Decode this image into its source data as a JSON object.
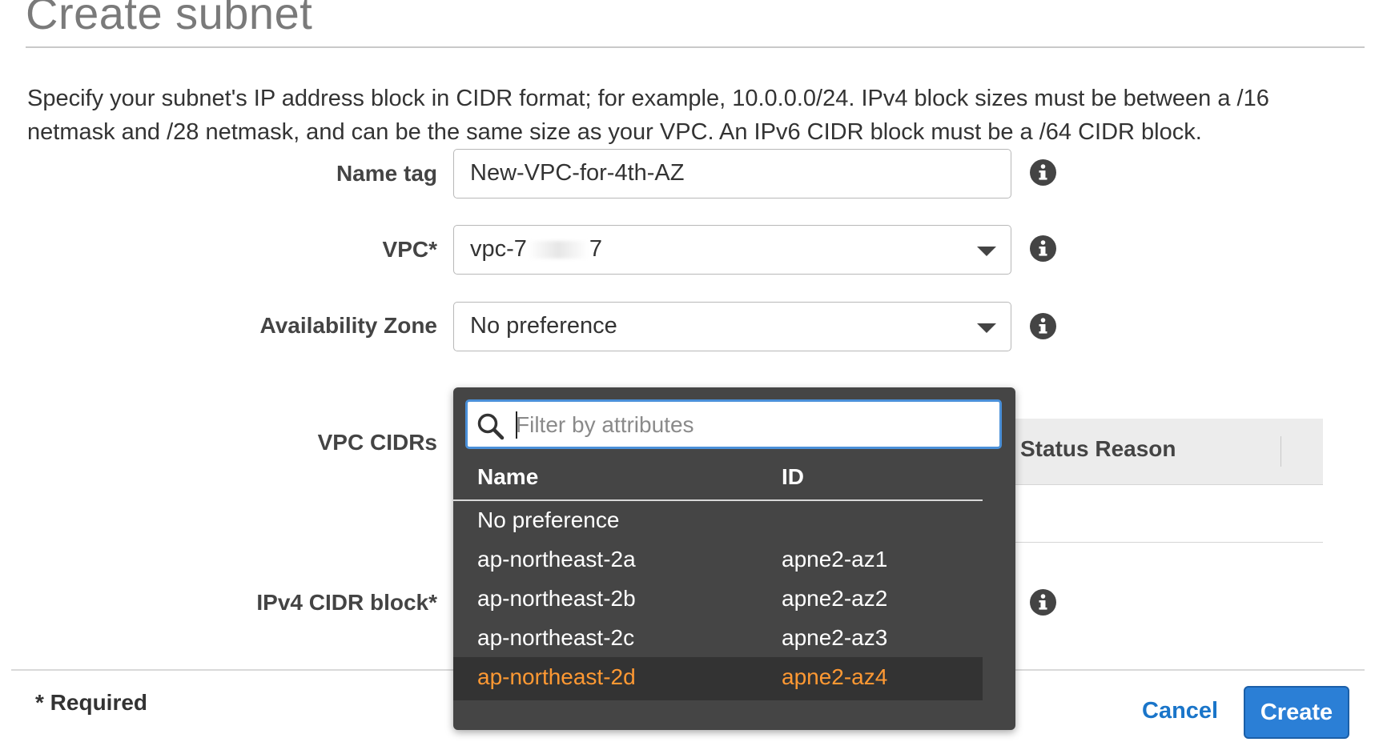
{
  "page": {
    "title": "Create subnet",
    "description": "Specify your subnet's IP address block in CIDR format; for example, 10.0.0.0/24. IPv4 block sizes must be between a /16 netmask and /28 netmask, and can be the same size as your VPC. An IPv6 CIDR block must be a /64 CIDR block."
  },
  "form": {
    "name_tag": {
      "label": "Name tag",
      "value": "New-VPC-for-4th-AZ"
    },
    "vpc": {
      "label": "VPC*",
      "value_prefix": "vpc-7",
      "value_suffix": "7"
    },
    "availability_zone": {
      "label": "Availability Zone",
      "value": "No preference"
    },
    "vpc_cidrs": {
      "label": "VPC CIDRs",
      "table_header": "Status Reason"
    },
    "ipv4_cidr": {
      "label": "IPv4 CIDR block*"
    }
  },
  "dropdown": {
    "filter_placeholder": "Filter by attributes",
    "columns": {
      "name": "Name",
      "id": "ID"
    },
    "options": [
      {
        "name": "No preference",
        "id": ""
      },
      {
        "name": "ap-northeast-2a",
        "id": "apne2-az1"
      },
      {
        "name": "ap-northeast-2b",
        "id": "apne2-az2"
      },
      {
        "name": "ap-northeast-2c",
        "id": "apne2-az3"
      },
      {
        "name": "ap-northeast-2d",
        "id": "apne2-az4"
      }
    ]
  },
  "footer": {
    "required_note": "* Required",
    "cancel_label": "Cancel",
    "create_label": "Create"
  },
  "colors": {
    "primary_button": "#2b7fd6",
    "link": "#1a75c9",
    "dropdown_bg": "#454545",
    "highlight": "#ff9933",
    "focus_border": "#4a90d9"
  }
}
